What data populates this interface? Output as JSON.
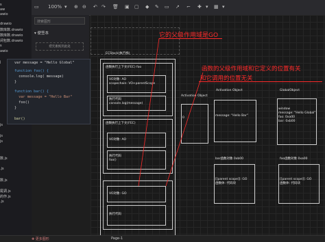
{
  "file_tree": {
    "items": [
      "s",
      "aw",
      "awio",
      "drawio",
      "数库数.drawio",
      "数库数.drawio",
      "闭包数.drawio",
      "s",
      "awio",
      "",
      "j",
      "",
      "js",
      "js",
      "js",
      "",
      "",
      "数.js",
      "",
      ".js",
      "",
      "数.js",
      "",
      "尾调.js",
      "的作.js",
      ".js"
    ]
  },
  "toolbar": {
    "zoom": "100%"
  },
  "panel": {
    "search_placeholder": "搜索图形",
    "scratchpad": "便签本",
    "drop_hint": "把元素拖到此处"
  },
  "code": {
    "line1": "var message = \"Hello Global\"",
    "line2": "function foo() {",
    "line3": "  console.log( message)",
    "line4": "}",
    "line5": "function bar() {",
    "line6": "  var message = \"Hello Bar\"",
    "line7": "  foo()",
    "line8": "}",
    "line9": "bar()"
  },
  "diagram": {
    "ecstack": "ECStack(执行栈)",
    "fec_foo": "函数执行上下文(FEC) foo",
    "vo_foo": "VO对象: AO\nscopechain: VO+parentScope",
    "code_foo": "执行代码\nconsole.log(message)",
    "fec_bar": "函数执行上下文(FEC)",
    "vo_bar": "VO对象: AO",
    "code_bar": "执行代码\nfoo()",
    "vo_go": "VO对象: GO",
    "code_go": "执行代码",
    "activation_small": "Activation Object",
    "ao_zero": "0",
    "activation": "Activation Object",
    "ao_msg": "message: \"Hello Bar\"",
    "global": "GlobalObject",
    "global_body": "window\nmessage: \"Hello Global\"\nfoo: 0xa00\nbar: 0xb00",
    "bar_title": "bar函数对象 0xb00",
    "bar_body": "[[parent scope]]: GO\n函数体: 代码块",
    "foo_title": "foo函数对象 0xa00",
    "foo_body": "[[parent scope]]: GO\n函数体: 代码块"
  },
  "annotations": {
    "top": "它的父级作用域是GO",
    "mid1": "函数的父级作用域和它定义的位置有关",
    "mid2": "和它调用的位置无关"
  },
  "bottom": {
    "more": "更多图形",
    "page": "Page-1"
  },
  "colors": {
    "annotation": "#ff2a2a",
    "panel": "#232327"
  }
}
